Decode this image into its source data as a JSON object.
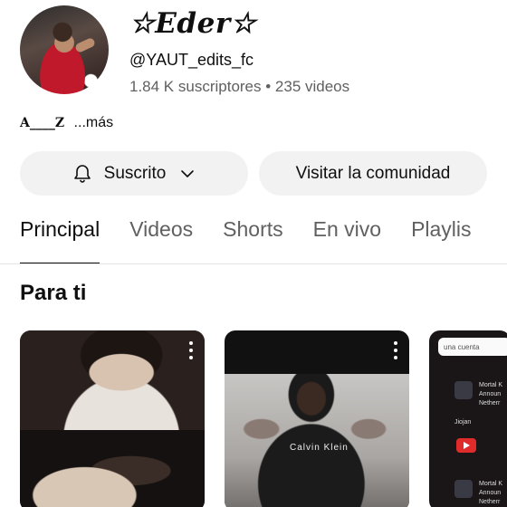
{
  "channel": {
    "name": "☆Eder☆",
    "handle": "@YAUT_edits_fc",
    "stats": "1.84 K suscriptores • 235 videos",
    "description": "A____Z",
    "more_label": "...más"
  },
  "actions": {
    "subscribed_label": "Suscrito",
    "community_label": "Visitar la comunidad"
  },
  "tabs": [
    {
      "label": "Principal",
      "active": true
    },
    {
      "label": "Videos",
      "active": false
    },
    {
      "label": "Shorts",
      "active": false
    },
    {
      "label": "En vivo",
      "active": false
    },
    {
      "label": "Playlis",
      "active": false
    }
  ],
  "section": {
    "title": "Para ti"
  },
  "cards": [
    {
      "overlay_text": ""
    },
    {
      "overlay_text": "Calvin Klein"
    },
    {
      "panel_text": "una cuenta",
      "rows": [
        "Mortal K",
        "Announ",
        "Netherr",
        "Jiojan",
        "Mortal K",
        "Announ",
        "Netherr"
      ]
    }
  ]
}
